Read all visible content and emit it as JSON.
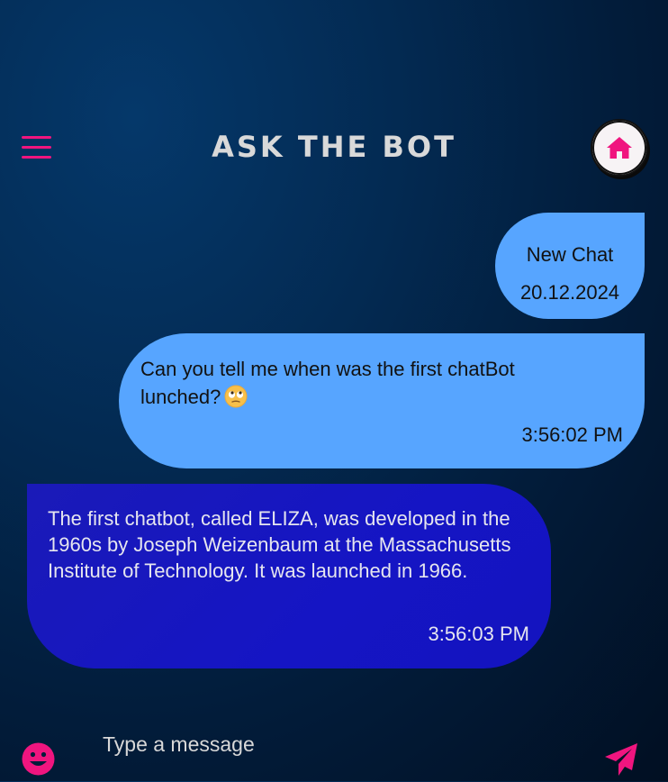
{
  "header": {
    "title": "ASK THE BOT",
    "menu_icon": "hamburger-menu-icon",
    "home_icon": "home-icon"
  },
  "messages": {
    "new_chat": {
      "label": "New Chat",
      "date": "20.12.2024"
    },
    "user": {
      "text": "Can you tell me when was the first chatBot lunched?",
      "emoji": "rolling-eyes-emoji",
      "time": "3:56:02 PM"
    },
    "bot": {
      "text": "The first chatbot, called ELIZA, was developed in the 1960s by Joseph Weizenbaum at the Massachusetts Institute of Technology. It was launched in 1966.",
      "time": "3:56:03 PM"
    }
  },
  "composer": {
    "placeholder": "Type a message",
    "value": "",
    "emoji_icon": "smiley-icon",
    "send_icon": "paper-plane-icon"
  },
  "colors": {
    "accent": "#f0157f",
    "user_bubble": "#57a5ff",
    "bot_bubble": "#1515c4",
    "title": "#d9d9d9"
  }
}
